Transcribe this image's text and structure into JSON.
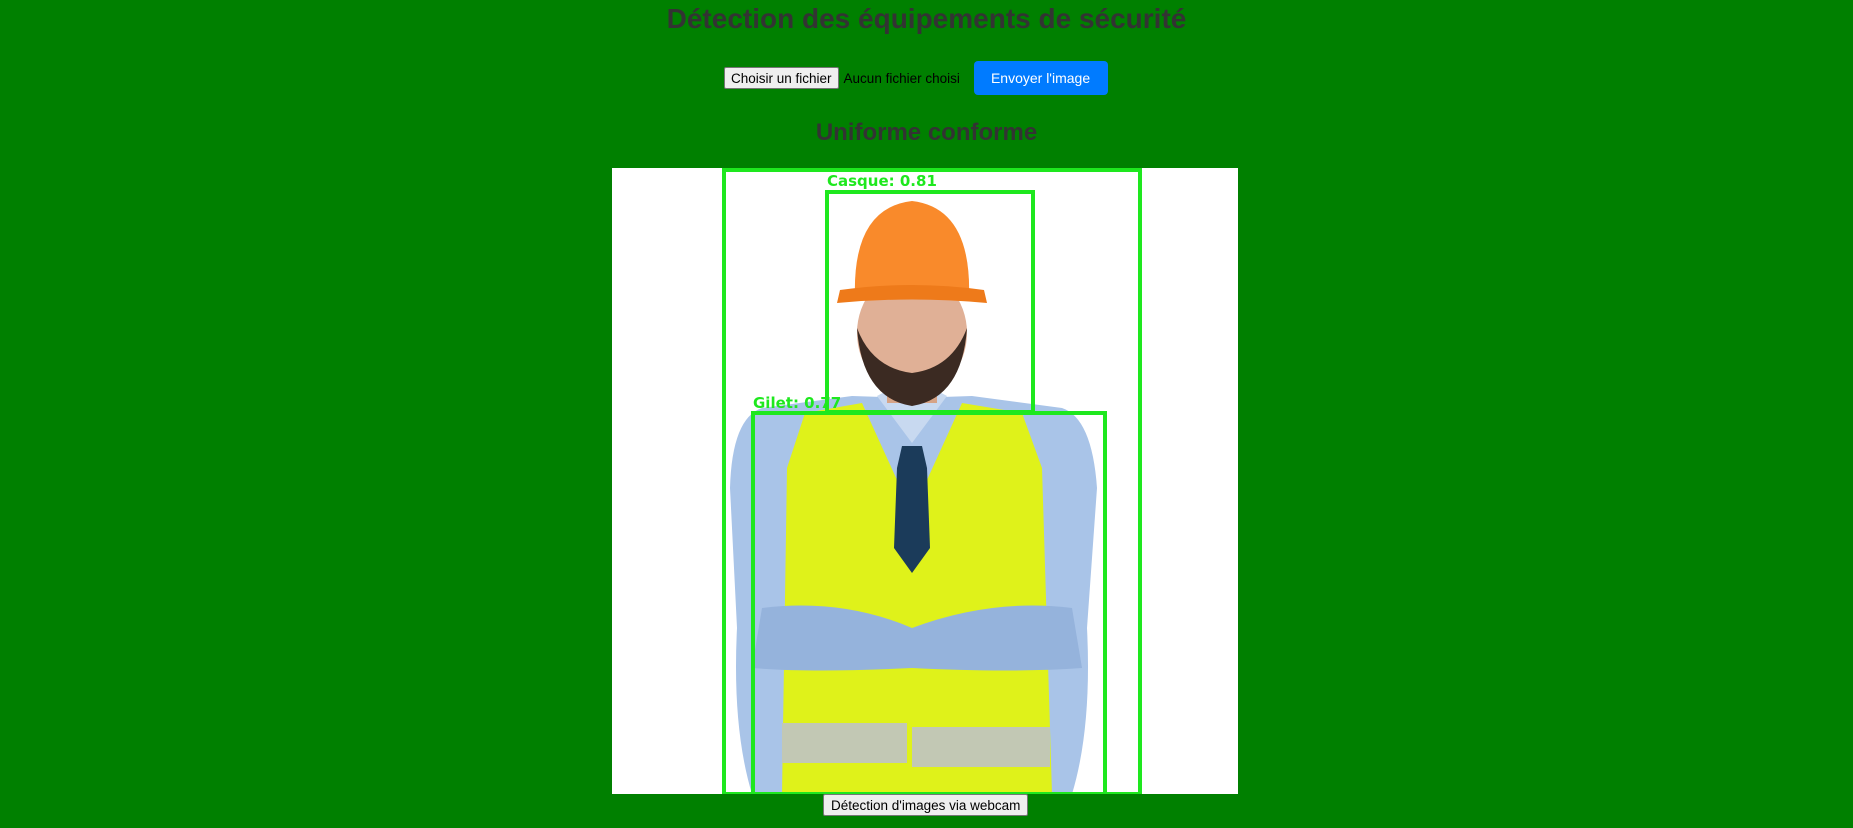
{
  "page": {
    "title": "Détection des équipements de sécurité"
  },
  "upload": {
    "file_button_label": "Choisir un fichier",
    "file_status": "Aucun fichier choisi",
    "send_button_label": "Envoyer l'image"
  },
  "result": {
    "heading": "Uniforme conforme",
    "detections": [
      {
        "label": "Casque: 0.81"
      },
      {
        "label": "Gilet: 0.77"
      }
    ]
  },
  "webcam": {
    "button_label": "Détection d'images via webcam"
  },
  "colors": {
    "background": "#008000",
    "heading_text": "#333333",
    "send_button": "#007bff",
    "bbox": "#1ee81e"
  }
}
